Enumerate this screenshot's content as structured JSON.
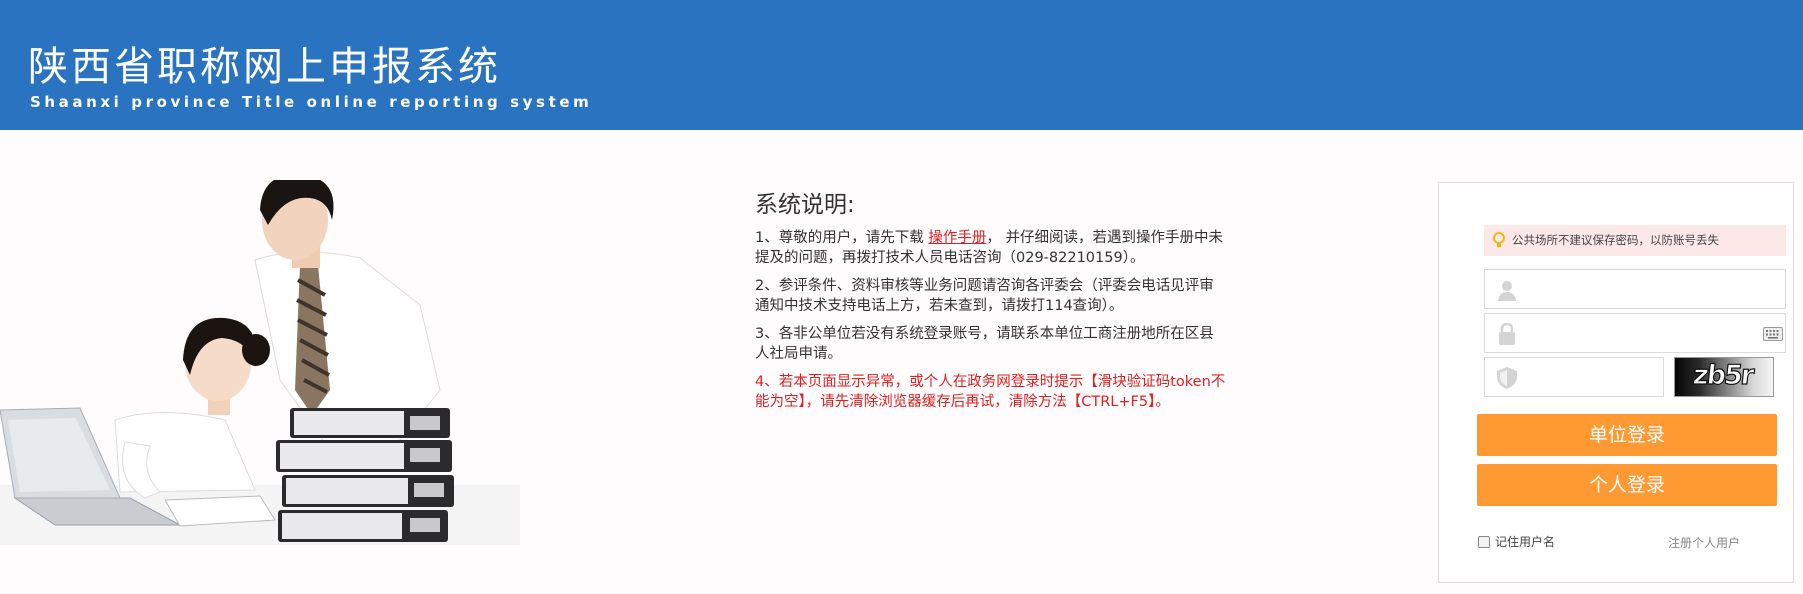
{
  "header": {
    "title": "陕西省职称网上申报系统",
    "subtitle": "Shaanxi province Title online reporting system",
    "background_color": "#2a73c0"
  },
  "illustration": {
    "description_icon": "people-with-laptop-and-binders-photo"
  },
  "instructions": {
    "title": "系统说明:",
    "item1_prefix": "1、尊敬的用户，请先下载 ",
    "item1_link": "操作手册",
    "item1_suffix": "， 并仔细阅读，若遇到操作手册中未提及的问题，再拨打技术人员电话咨询（029-82210159）。",
    "item2": "2、参评条件、资料审核等业务问题请咨询各评委会（评委会电话见评审通知中技术支持电话上方，若未查到，请拨打114查询）。",
    "item3": "3、各非公单位若没有系统登录账号，请联系本单位工商注册地所在区县人社局申请。",
    "item4": "4、若本页面显示异常，或个人在政务网登录时提示【滑块验证码token不能为空】，请先清除浏览器缓存后再试，清除方法【CTRL+F5】。",
    "warning_color": "#e02020"
  },
  "login": {
    "tip": "公共场所不建议保存密码，以防账号丢失",
    "username_value": "",
    "password_value": "",
    "captcha_value": "",
    "captcha_text": "zb5r",
    "unit_login_label": "单位登录",
    "personal_login_label": "个人登录",
    "remember_label": "记住用户名",
    "register_label": "注册个人用户",
    "button_color": "#ff9a33",
    "icons": {
      "tip": "lightbulb-icon",
      "username": "user-icon",
      "password": "lock-icon",
      "captcha": "shield-icon",
      "keyboard": "keyboard-icon"
    }
  }
}
